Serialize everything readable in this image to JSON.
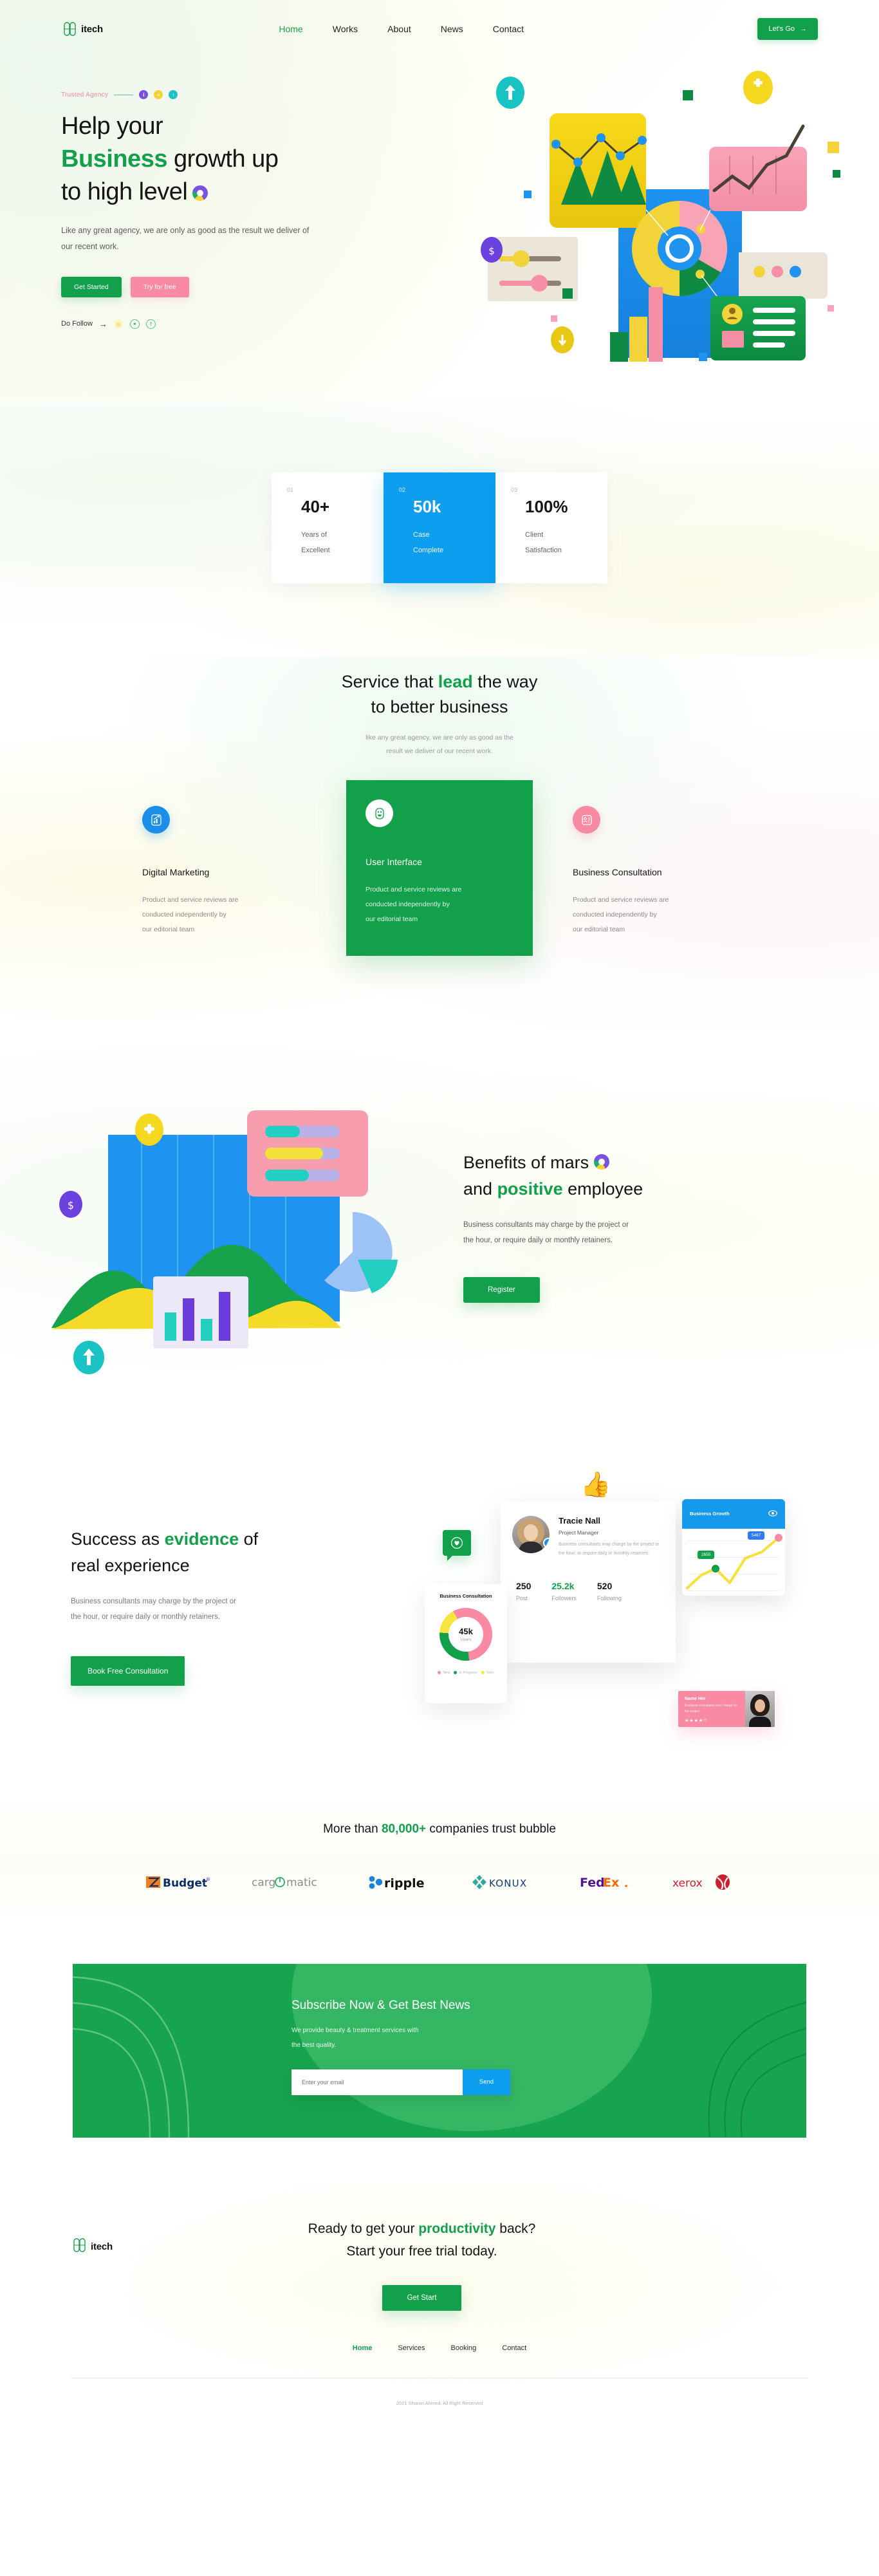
{
  "brand": {
    "name": "itech",
    "accent": "#12a04a",
    "blue": "#0e9ef0",
    "pink": "#f98aa4",
    "yellow": "#f2d43a"
  },
  "nav": {
    "links": [
      {
        "label": "Home",
        "active": true
      },
      {
        "label": "Works",
        "active": false
      },
      {
        "label": "About",
        "active": false
      },
      {
        "label": "News",
        "active": false
      },
      {
        "label": "Contact",
        "active": false
      }
    ],
    "cta": "Let's Go"
  },
  "hero": {
    "eyebrow": "Trusted Agency",
    "title_1": "Help your",
    "title_hl": "Business",
    "title_2": " growth up",
    "title_3": "to high level",
    "subtitle": "Like any great agency, we are only as good as the result we deliver of our recent work.",
    "btn_primary": "Get Started",
    "btn_secondary": "Try for free",
    "follow_label": "Do Follow"
  },
  "stats": {
    "items": [
      {
        "index": "01",
        "value": "40+",
        "line1": "Years of",
        "line2": "Excellent"
      },
      {
        "index": "02",
        "value": "50k",
        "line1": "Case",
        "line2": "Complete"
      },
      {
        "index": "03",
        "value": "100%",
        "line1": "Client",
        "line2": "Satisfaction"
      }
    ]
  },
  "services": {
    "title_1": "Service that ",
    "title_hl": "lead",
    "title_2": " the way",
    "title_3": "to better business",
    "subtitle_1": "like any great agency, we are only as good as the",
    "subtitle_2": "result we deliver of our recent work.",
    "cards": [
      {
        "title": "Digital Marketing",
        "body_1": "Product and service reviews are",
        "body_2": "conducted independently by",
        "body_3": "our editorial team",
        "icon": "chart-growth-icon"
      },
      {
        "title": "User Interface",
        "body_1": "Product and service reviews are",
        "body_2": "conducted independently by",
        "body_3": "our editorial team",
        "icon": "smiley-face-icon"
      },
      {
        "title": "Business Consultation",
        "body_1": "Product and service reviews are",
        "body_2": "conducted independently by",
        "body_3": "our editorial team",
        "icon": "id-card-icon"
      }
    ]
  },
  "benefits": {
    "title_1": "Benefits of mars",
    "title_2": "and ",
    "title_hl": "positive",
    "title_3": " employee",
    "sub_1": "Business consultants may charge by the project or",
    "sub_2": "the hour, or require daily or monthly retainers.",
    "button": "Register"
  },
  "success": {
    "title_1": "Success as ",
    "title_hl": "evidence",
    "title_2": " of",
    "title_3": "real experience",
    "sub_1": "Business consultants may charge by the project or",
    "sub_2": "the hour, or require daily or monthly retainers.",
    "button": "Book Free Consultation",
    "profile": {
      "name": "Tracie Nall",
      "role": "Project Manager",
      "desc": "Business consultants may charge by the project or the hour, or require daily or monthly retainers.",
      "stats": [
        {
          "value": "250",
          "label": "Post"
        },
        {
          "value": "25.2k",
          "label": "Followers"
        },
        {
          "value": "520",
          "label": "Following"
        }
      ]
    },
    "growth_card": {
      "title": "Business Growth",
      "tag_high": "5467",
      "tag_low": "2655"
    },
    "donut_card": {
      "title": "Business Consultation",
      "value": "45k",
      "label": "Users",
      "legend": [
        {
          "name": "New",
          "color": "#f98aa4"
        },
        {
          "name": "In Progress",
          "color": "#12a04a"
        },
        {
          "name": "Todo",
          "color": "#f4e63c"
        }
      ]
    },
    "review_card": {
      "name": "Name Her",
      "text": "Business consultants may charge by the project",
      "stars": "★★★★✩"
    }
  },
  "trust": {
    "title_1": "More than ",
    "title_hl": "80,000+",
    "title_2": " companies trust bubble",
    "logos": [
      "Budget",
      "cargomatic",
      "ripple",
      "KONUX",
      "FedEx",
      "xerox"
    ]
  },
  "newsletter": {
    "title": "Subscribe Now & Get Best News",
    "sub_1": "We provide beauty & treatment services with",
    "sub_2": "the best quality.",
    "placeholder": "Enter your email",
    "input_value": "",
    "send": "Send"
  },
  "footer": {
    "title_1": "Ready to get your ",
    "title_hl": "productivity",
    "title_2": " back?",
    "title_3": "Start your free trial today.",
    "button": "Get Start",
    "links": [
      {
        "label": "Home",
        "active": true
      },
      {
        "label": "Services",
        "active": false
      },
      {
        "label": "Booking",
        "active": false
      },
      {
        "label": "Contact",
        "active": false
      }
    ],
    "copyright": "2021 Sharon Ahmed. All Right Reserved"
  },
  "chart_data": [
    {
      "type": "line",
      "title": "Business Growth",
      "x": [
        0,
        1,
        2,
        3,
        4,
        5
      ],
      "values": [
        10,
        35,
        48,
        22,
        62,
        88
      ],
      "annotations": [
        {
          "label": "2655",
          "at": 2
        },
        {
          "label": "5467",
          "at": 5
        }
      ],
      "grid": true,
      "ylim": [
        0,
        100
      ]
    },
    {
      "type": "pie",
      "title": "Business Consultation",
      "center_value": "45k",
      "center_label": "Users",
      "categories": [
        "New",
        "In Progress",
        "Todo"
      ],
      "values": [
        56,
        28,
        16
      ],
      "colors": [
        "#f98aa4",
        "#12a04a",
        "#f4e63c"
      ],
      "legend": "bottom"
    }
  ]
}
